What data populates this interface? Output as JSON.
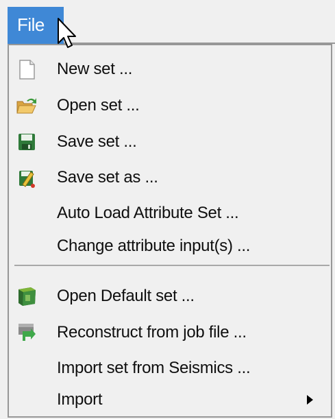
{
  "menubar": {
    "file_label": "File"
  },
  "menu": {
    "items": [
      {
        "label": "New set ...",
        "icon": "new-document-icon"
      },
      {
        "label": "Open set ...",
        "icon": "open-folder-icon"
      },
      {
        "label": "Save set ...",
        "icon": "floppy-save-icon"
      },
      {
        "label": "Save set as ...",
        "icon": "save-as-icon"
      },
      {
        "label": "Auto Load Attribute Set ...",
        "icon": ""
      },
      {
        "label": "Change attribute input(s) ...",
        "icon": ""
      },
      {
        "label": "Open Default set ...",
        "icon": "default-set-cube-icon"
      },
      {
        "label": "Reconstruct from job file ...",
        "icon": "reconstruct-icon"
      },
      {
        "label": "Import set from Seismics ...",
        "icon": ""
      },
      {
        "label": "Import",
        "icon": "",
        "submenu": true
      }
    ]
  },
  "colors": {
    "menu_highlight": "#3f88d6",
    "menu_background": "#f0f0f0",
    "text": "#0f0f0f"
  }
}
